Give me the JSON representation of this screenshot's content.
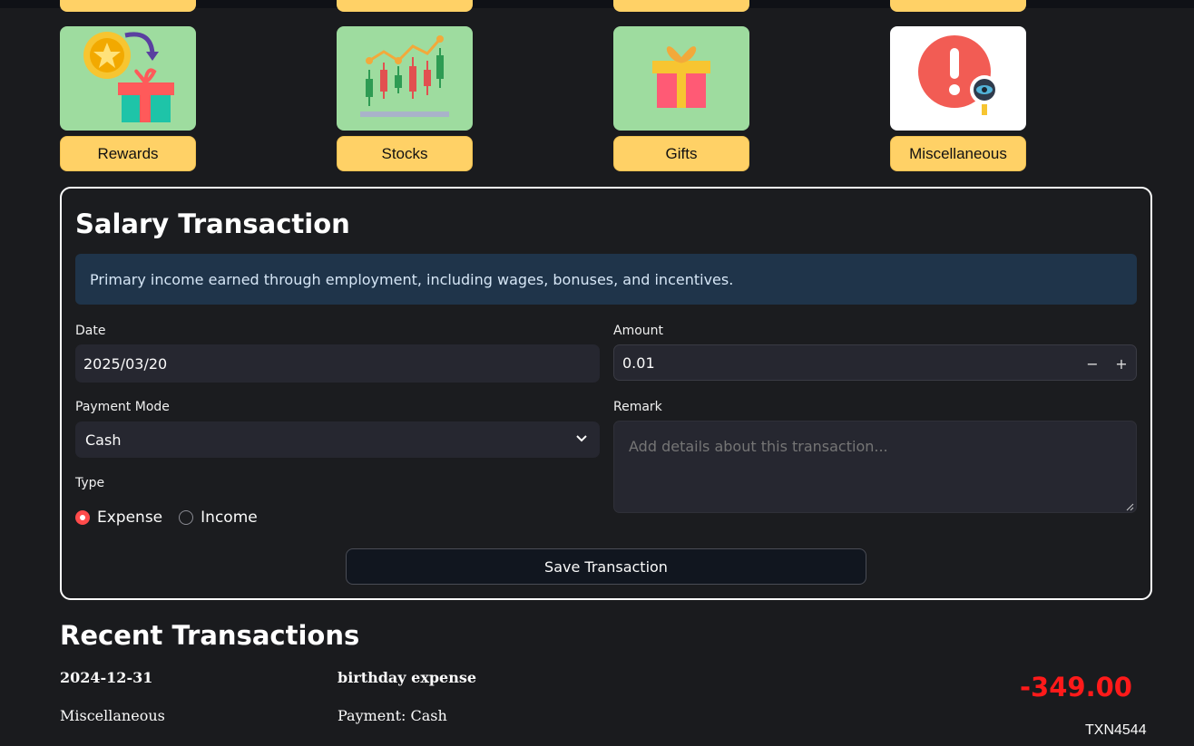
{
  "categories": [
    {
      "label": "Rewards",
      "icon": "reward-gift-icon",
      "bg": "#9edc9f"
    },
    {
      "label": "Stocks",
      "icon": "stock-chart-icon",
      "bg": "#9edc9f"
    },
    {
      "label": "Gifts",
      "icon": "gift-box-icon",
      "bg": "#9edc9f"
    },
    {
      "label": "Miscellaneous",
      "icon": "alert-search-icon",
      "bg": "#ffffff"
    }
  ],
  "form": {
    "title": "Salary Transaction",
    "description": "Primary income earned through employment, including wages, bonuses, and incentives.",
    "date_label": "Date",
    "date_value": "2025/03/20",
    "amount_label": "Amount",
    "amount_value": "0.01",
    "amount_minus": "−",
    "amount_plus": "+",
    "payment_label": "Payment Mode",
    "payment_value": "Cash",
    "remark_label": "Remark",
    "remark_placeholder": "Add details about this transaction...",
    "type_label": "Type",
    "type_options": [
      "Expense",
      "Income"
    ],
    "type_selected": "Expense",
    "save_label": "Save Transaction"
  },
  "recent": {
    "title": "Recent Transactions",
    "items": [
      {
        "date": "2024-12-31",
        "description": "birthday expense",
        "category": "Miscellaneous",
        "payment": "Payment: Cash",
        "amount": "-349.00",
        "id": "TXN4544"
      }
    ]
  },
  "colors": {
    "accent": "#ffd166",
    "danger": "#ff1a1a",
    "radio_active": "#ff4b4b",
    "info_bg": "#1f344a"
  }
}
